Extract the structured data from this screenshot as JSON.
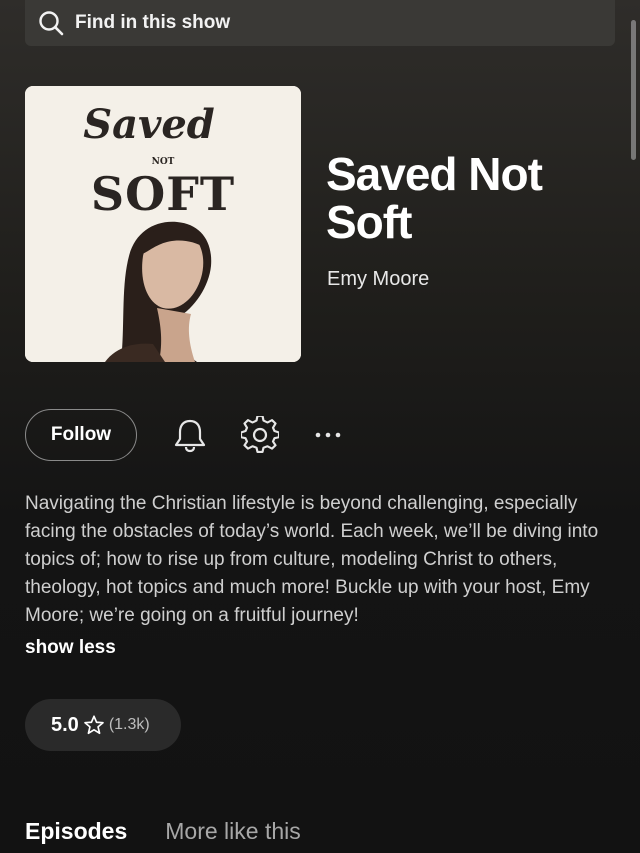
{
  "search": {
    "label": "Find in this show",
    "icon": "search-icon"
  },
  "cover": {
    "art_text_top": "Saved",
    "art_text_mid": "NOT",
    "art_text_bottom": "SOFT"
  },
  "show": {
    "title": "Saved Not Soft",
    "author": "Emy Moore"
  },
  "actions": {
    "follow_label": "Follow",
    "bell_icon": "bell-icon",
    "settings_icon": "gear-icon",
    "more_icon": "more-options-icon"
  },
  "description": {
    "text": "Navigating the Christian lifestyle is beyond challenging, especially facing the obstacles of today’s world. Each week, we’ll be diving into topics of; how to rise up from culture, modeling Christ to others, theology, hot topics and much more! Buckle up with your host, Emy Moore; we’re going on a fruitful journey!",
    "toggle_label": "show less"
  },
  "rating": {
    "value": "5.0",
    "count": "(1.3k)",
    "icon": "star-icon"
  },
  "tabs": [
    {
      "label": "Episodes",
      "active": true
    },
    {
      "label": "More like this",
      "active": false
    }
  ],
  "colors": {
    "background_top": "#2f2d2a",
    "background_bottom": "#121212",
    "text_secondary": "#cfcfcf",
    "pill_bg": "#2a2a2a"
  }
}
